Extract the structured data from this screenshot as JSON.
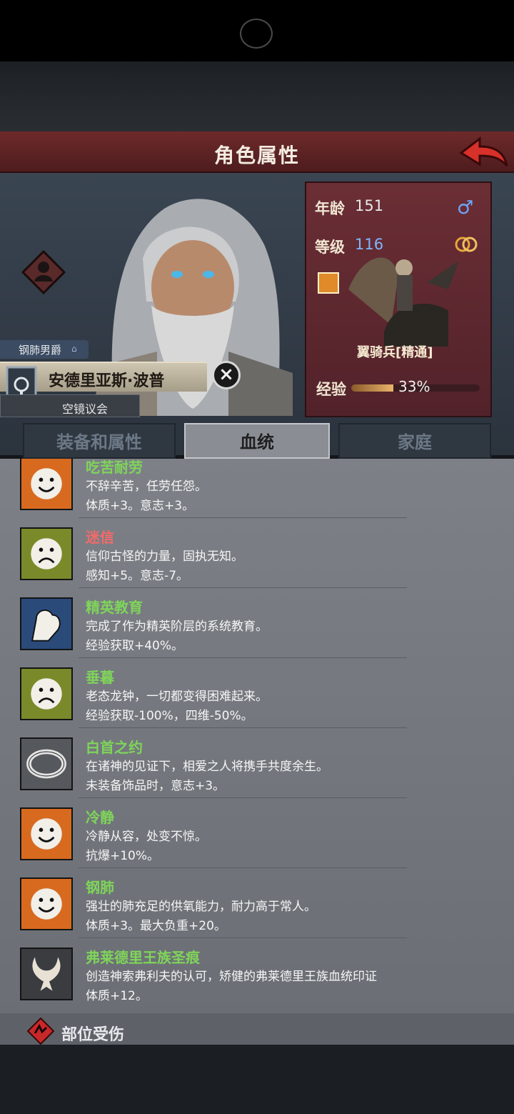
{
  "header": {
    "title": "角色属性"
  },
  "character": {
    "title_tag": "钢肺男爵",
    "name": "安德里亚斯·波普",
    "faction": "空镜议会"
  },
  "stats": {
    "age_label": "年龄",
    "age_value": "151",
    "level_label": "等级",
    "level_value": "116",
    "unit_name": "翼骑兵[精通]",
    "exp_label": "经验",
    "exp_value": "33%",
    "exp_fraction": 0.33
  },
  "tabs": [
    {
      "label": "装备和属性"
    },
    {
      "label": "血统"
    },
    {
      "label": "家庭"
    }
  ],
  "traits": [
    {
      "name": "吃苦耐劳",
      "name_color": "#7fd45a",
      "desc": "不辞辛苦，任劳任怨。",
      "effect": "体质+3。意志+3。",
      "icon": "happy-face-icon"
    },
    {
      "name": "迷信",
      "name_color": "#f26a6a",
      "desc": "信仰古怪的力量，固执无知。",
      "effect": "感知+5。意志-7。",
      "icon": "sad-face-icon"
    },
    {
      "name": "精英教育",
      "name_color": "#7fd45a",
      "desc": "完成了作为精英阶层的系统教育。",
      "effect": "经验获取+40%。",
      "icon": "flexed-arm-icon"
    },
    {
      "name": "垂暮",
      "name_color": "#7fd45a",
      "desc": "老态龙钟，一切都变得困难起来。",
      "effect": "经验获取-100%，四维-50%。",
      "icon": "sad-face-icon"
    },
    {
      "name": "白首之约",
      "name_color": "#7fd45a",
      "desc": "在诸神的见证下，相爱之人将携手共度余生。",
      "effect": "未装备饰品时，意志+3。",
      "icon": "ring-icon"
    },
    {
      "name": "冷静",
      "name_color": "#7fd45a",
      "desc": "冷静从容，处变不惊。",
      "effect": "抗爆+10%。",
      "icon": "happy-face-icon"
    },
    {
      "name": "钢肺",
      "name_color": "#7fd45a",
      "desc": "强壮的肺充足的供氧能力，耐力高于常人。",
      "effect": "体质+3。最大负重+20。",
      "icon": "happy-face-icon"
    },
    {
      "name": "弗莱德里王族圣痕",
      "name_color": "#7fd45a",
      "desc": "创造神索弗利夫的认可，矫健的弗莱德里王族血统印证",
      "effect": "体质+12。",
      "icon": "horned-crest-icon"
    }
  ],
  "injury": {
    "label": "部位受伤"
  }
}
